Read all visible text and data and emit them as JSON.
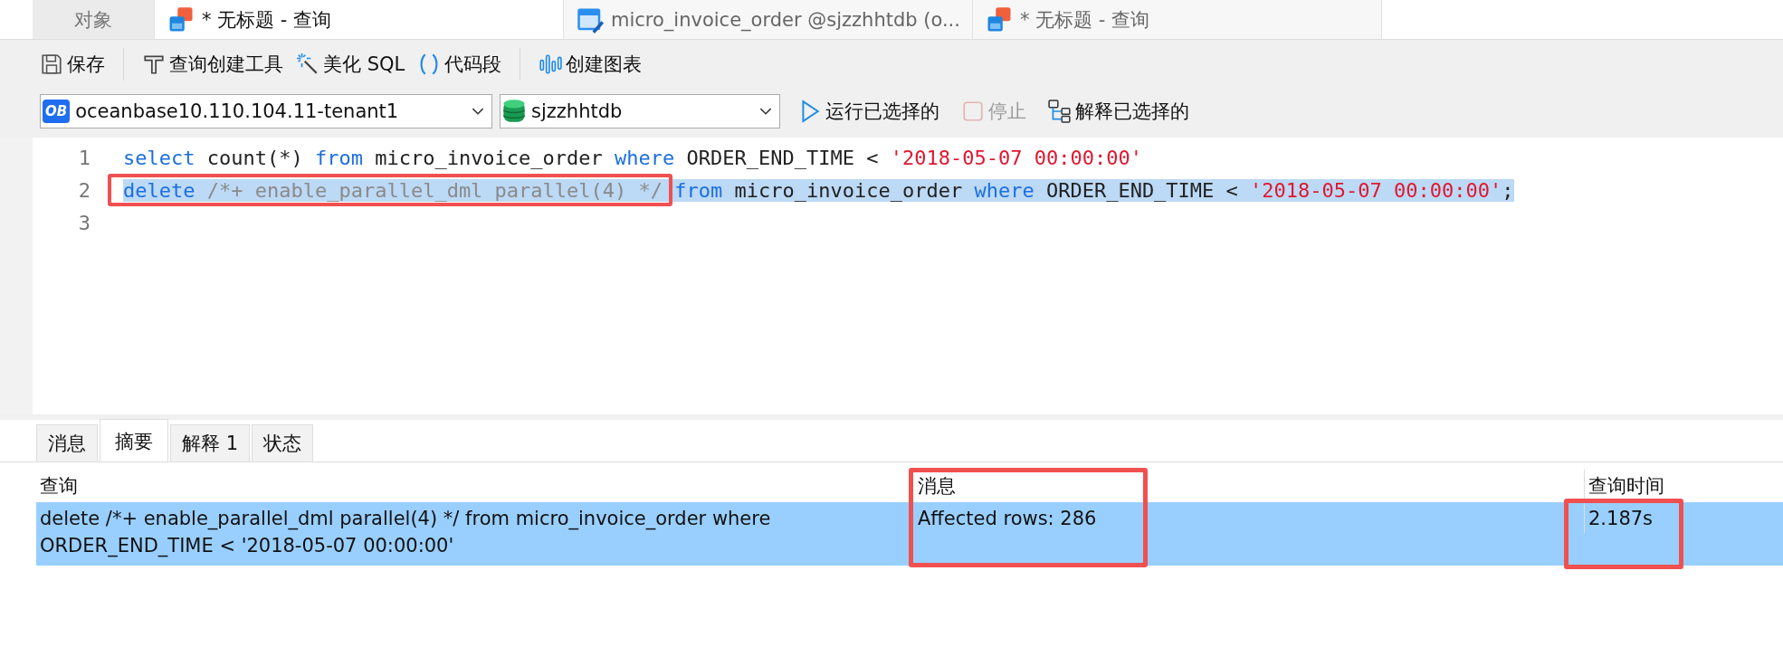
{
  "tabs": [
    {
      "label": "对象",
      "kind": "objects",
      "selected": false
    },
    {
      "label": "* 无标题 - 查询",
      "kind": "query",
      "selected": true
    },
    {
      "label": "micro_invoice_order @sjzzhhtdb (o...",
      "kind": "table",
      "selected": false
    },
    {
      "label": "* 无标题 - 查询",
      "kind": "query",
      "selected": false
    }
  ],
  "toolbar": [
    {
      "label": "保存",
      "kind": "save"
    },
    {
      "kind": "separator"
    },
    {
      "label": "查询创建工具",
      "kind": "builder"
    },
    {
      "label": "美化 SQL",
      "kind": "beautify"
    },
    {
      "label": "代码段",
      "kind": "snippet"
    },
    {
      "kind": "separator"
    },
    {
      "label": "创建图表",
      "kind": "chart"
    }
  ],
  "connection": {
    "value": "oceanbase10.110.104.11-tenant1",
    "badge": "OB"
  },
  "database": {
    "value": "sjzzhhtdb"
  },
  "actions": [
    {
      "label": "运行已选择的",
      "kind": "run",
      "disabled": false
    },
    {
      "label": "停止",
      "kind": "stop",
      "disabled": true
    },
    {
      "label": "解释已选择的",
      "kind": "explain",
      "disabled": false
    }
  ],
  "editor": {
    "lines": [
      {
        "number": "1",
        "selected": false,
        "tokens": [
          {
            "text": "select",
            "kind": "keyword"
          },
          {
            "text": " count(*) ",
            "kind": "plain"
          },
          {
            "text": "from",
            "kind": "keyword"
          },
          {
            "text": " micro_invoice_order ",
            "kind": "plain"
          },
          {
            "text": "where",
            "kind": "keyword"
          },
          {
            "text": " ORDER_END_TIME < ",
            "kind": "plain"
          },
          {
            "text": "'2018-05-07 00:00:00'",
            "kind": "string"
          }
        ]
      },
      {
        "number": "2",
        "selected": true,
        "tokens": [
          {
            "text": "delete",
            "kind": "keyword"
          },
          {
            "text": " /*+ enable_parallel_dml parallel(4) */ ",
            "kind": "comment"
          },
          {
            "text": "from",
            "kind": "keyword"
          },
          {
            "text": " micro_invoice_order ",
            "kind": "plain"
          },
          {
            "text": "where",
            "kind": "keyword"
          },
          {
            "text": " ORDER_END_TIME < ",
            "kind": "plain"
          },
          {
            "text": "'2018-05-07 00:00:00'",
            "kind": "string"
          },
          {
            "text": ";",
            "kind": "plain"
          }
        ]
      },
      {
        "number": "3",
        "selected": false
      }
    ]
  },
  "result_tabs": [
    {
      "label": "消息",
      "selected": false
    },
    {
      "label": "摘要",
      "selected": true
    },
    {
      "label": "解释 1",
      "selected": false
    },
    {
      "label": "状态",
      "selected": false
    }
  ],
  "table": {
    "columns": [
      "查询",
      "消息",
      "查询时间"
    ],
    "rows": [
      {
        "selected": true,
        "cells": [
          "delete /*+ enable_parallel_dml parallel(4) */ from micro_invoice_order where ORDER_END_TIME < '2018-05-07 00:00:00'",
          "Affected rows: 286",
          "2.187s"
        ]
      }
    ]
  }
}
